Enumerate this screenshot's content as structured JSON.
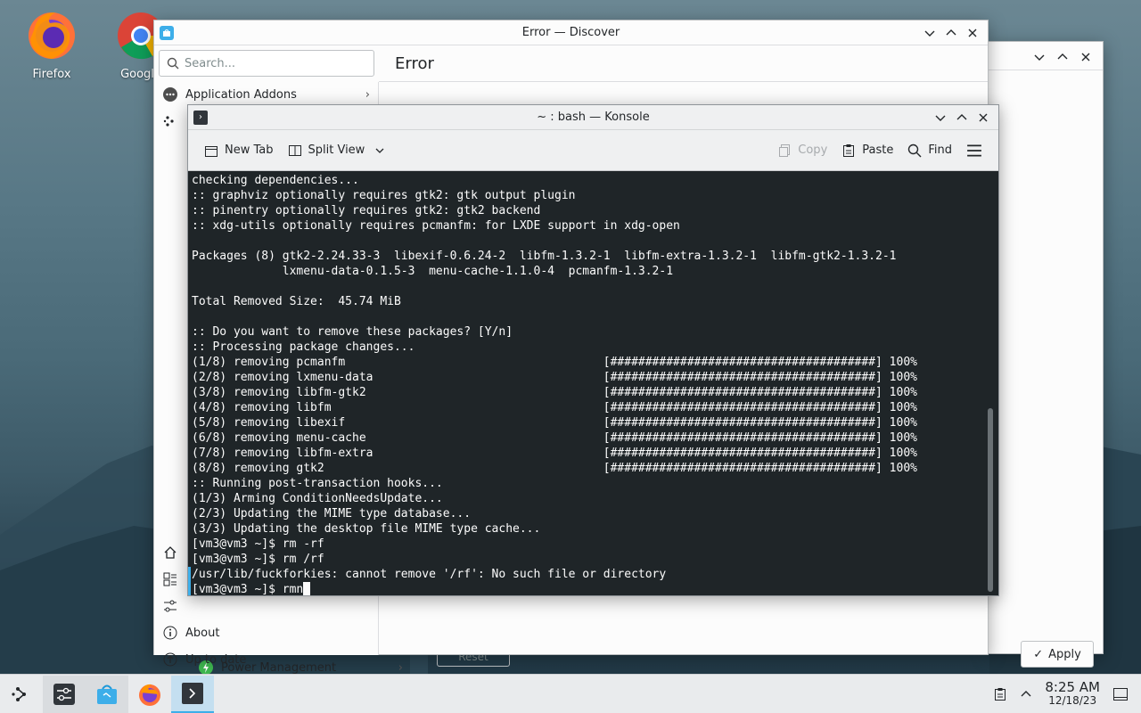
{
  "desktop": {
    "icons": [
      {
        "label": "Firefox"
      },
      {
        "label": "Google"
      }
    ]
  },
  "background_window": {
    "apply_label": "Apply"
  },
  "discover": {
    "title": "Error — Discover",
    "search_placeholder": "Search...",
    "page_title": "Error",
    "sidebar": {
      "first_item": "Application Addons",
      "about": "About",
      "up_to_date": "Up to date"
    }
  },
  "settings_partial": {
    "power_management": "Power Management",
    "reset": "Reset"
  },
  "konsole": {
    "title": "~ : bash — Konsole",
    "toolbar": {
      "new_tab": "New Tab",
      "split_view": "Split View",
      "copy": "Copy",
      "paste": "Paste",
      "find": "Find"
    },
    "lines": [
      "checking dependencies...",
      ":: graphviz optionally requires gtk2: gtk output plugin",
      ":: pinentry optionally requires gtk2: gtk2 backend",
      ":: xdg-utils optionally requires pcmanfm: for LXDE support in xdg-open",
      "",
      "Packages (8) gtk2-2.24.33-3  libexif-0.6.24-2  libfm-1.3.2-1  libfm-extra-1.3.2-1  libfm-gtk2-1.3.2-1",
      "             lxmenu-data-0.1.5-3  menu-cache-1.1.0-4  pcmanfm-1.3.2-1",
      "",
      "Total Removed Size:  45.74 MiB",
      "",
      ":: Do you want to remove these packages? [Y/n]",
      ":: Processing package changes...",
      "(1/8) removing pcmanfm                                     [######################################] 100%",
      "(2/8) removing lxmenu-data                                 [######################################] 100%",
      "(3/8) removing libfm-gtk2                                  [######################################] 100%",
      "(4/8) removing libfm                                       [######################################] 100%",
      "(5/8) removing libexif                                     [######################################] 100%",
      "(6/8) removing menu-cache                                  [######################################] 100%",
      "(7/8) removing libfm-extra                                 [######################################] 100%",
      "(8/8) removing gtk2                                        [######################################] 100%",
      ":: Running post-transaction hooks...",
      "(1/3) Arming ConditionNeedsUpdate...",
      "(2/3) Updating the MIME type database...",
      "(3/3) Updating the desktop file MIME type cache...",
      "[vm3@vm3 ~]$ rm -rf",
      "[vm3@vm3 ~]$ rm /rf",
      "/usr/lib/fuckforkies: cannot remove '/rf': No such file or directory"
    ],
    "prompt_line": "[vm3@vm3 ~]$ rmn"
  },
  "taskbar": {
    "time": "8:25 AM",
    "date": "12/18/23"
  },
  "colors": {
    "accent": "#3daee9",
    "terminal_bg": "#1f2528",
    "terminal_fg": "#fcfcfc"
  }
}
